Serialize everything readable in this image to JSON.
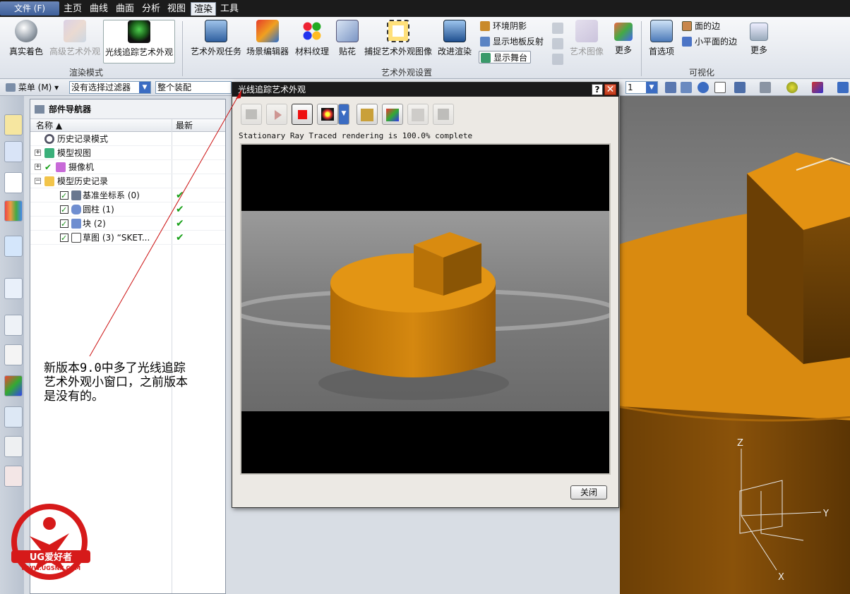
{
  "menubar": {
    "file": "文件 (F)",
    "tabs": [
      "主页",
      "曲线",
      "曲面",
      "分析",
      "视图",
      "渲染",
      "工具"
    ],
    "active_tab": "渲染"
  },
  "ribbon": {
    "render_mode": {
      "buttons": [
        "真实着色",
        "高级艺术外观",
        "光线追踪艺术外观"
      ],
      "label": "渲染模式"
    },
    "appearance": {
      "buttons": [
        "艺术外观任务",
        "场景编辑器",
        "材料纹理",
        "贴花",
        "捕捉艺术外观图像",
        "改进渲染"
      ],
      "small": [
        "环境阴影",
        "显示地板反射",
        "显示舞台"
      ],
      "disabled": [
        "艺术图像"
      ],
      "more": "更多",
      "label": "艺术外观设置"
    },
    "visualization": {
      "preferences": "首选项",
      "small": [
        "面的边",
        "小平面的边"
      ],
      "more": "更多",
      "label": "可视化"
    }
  },
  "toolbar": {
    "menu": "菜单 (M) ▾",
    "filter": "没有选择过滤器",
    "assembly": "整个装配",
    "count": "1"
  },
  "navigator": {
    "title": "部件导航器",
    "col_name": "名称",
    "col_latest": "最新",
    "rows": [
      {
        "label": "历史记录模式",
        "latest": ""
      },
      {
        "label": "模型视图",
        "latest": ""
      },
      {
        "label": "摄像机",
        "latest": ""
      },
      {
        "label": "模型历史记录",
        "latest": ""
      },
      {
        "label": "基准坐标系 (0)",
        "latest": "✔"
      },
      {
        "label": "圆柱 (1)",
        "latest": "✔"
      },
      {
        "label": "块 (2)",
        "latest": "✔"
      },
      {
        "label": "草图 (3) “SKET...",
        "latest": "✔"
      }
    ]
  },
  "dialog": {
    "title": "光线追踪艺术外观",
    "help": "?",
    "close_x": "✕",
    "status": "Stationary Ray Traced rendering is 100.0% complete",
    "progress": 1.0,
    "close_button": "关闭"
  },
  "annotation": {
    "text": "新版本9.0中多了光线追踪\n艺术外观小窗口，之前版本\n是没有的。"
  },
  "viewport": {
    "axes": [
      "Z",
      "Y",
      "X"
    ]
  },
  "logo": {
    "text": "UG爱好者",
    "url": "WWW.UGSNX.COM"
  },
  "colors": {
    "orange": "#d98a10",
    "accent": "#3b6cc2",
    "annotation_line": "#cc1111"
  }
}
